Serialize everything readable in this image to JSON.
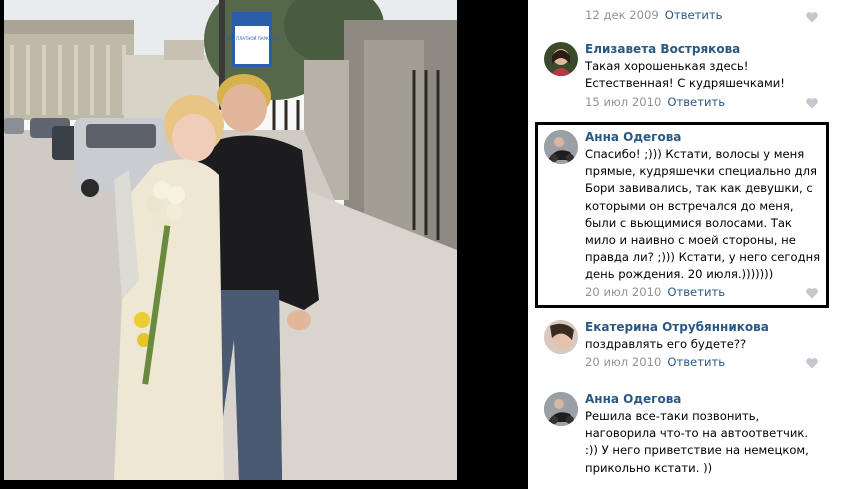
{
  "comments": [
    {
      "author": "",
      "text": "",
      "date": "12 дек 2009",
      "reply": "Ответить"
    },
    {
      "author": "Елизавета Вострякова",
      "text": "Такая хорошенькая здесь!\nЕстественная! С кудряшечками!",
      "date": "15 июл 2010",
      "reply": "Ответить"
    },
    {
      "author": "Анна Одегова",
      "text": "Спасибо! ;))) Кстати, волосы у меня\nпрямые, кудряшечки специально для\nБори завивались, так как девушки, с\nкоторыми он встречался до меня,\nбыли с вьющимися волосами. Так\nмило и наивно с моей стороны, не\nправда ли? ;))) Кстати, у него сегодня\nдень рождения. 20 июля.)))))))",
      "date": "20 июл 2010",
      "reply": "Ответить"
    },
    {
      "author": "Екатерина Отрубянникова",
      "text": "поздравлять его будете??",
      "date": "20 июл 2010",
      "reply": "Ответить"
    },
    {
      "author": "Анна Одегова",
      "text": "Решила все-таки позвонить,\nнаговорила что-то на автоответчик.\n:)) У него приветствие на немецком,\nприкольно кстати. ))",
      "date": "",
      "reply": ""
    }
  ],
  "photo": {
    "street_sign_text": "ЗОНА ПЛАТНОЙ ПАРКОВКИ"
  },
  "colors": {
    "link": "#2a5885",
    "date": "#939393",
    "viewer_bg": "#000000",
    "highlight_border": "#000000"
  }
}
